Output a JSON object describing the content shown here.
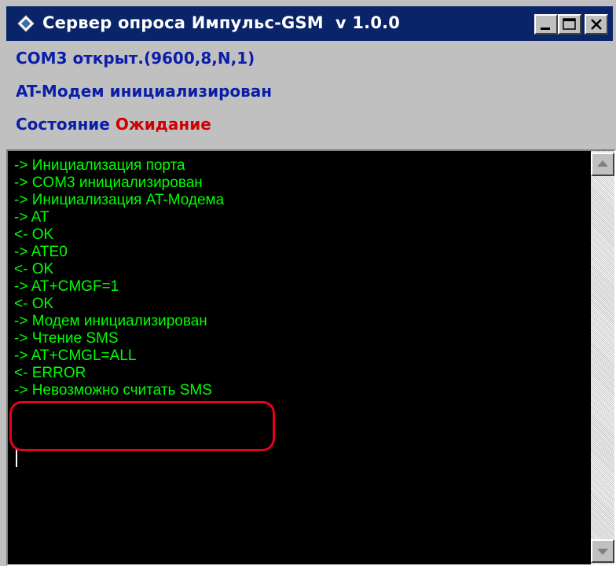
{
  "window": {
    "title": "Сервер опроса Импульс-GSM  v 1.0.0",
    "icons": {
      "app": "diamond-icon",
      "minimize": "minimize-icon",
      "maximize": "maximize-icon",
      "close": "close-icon"
    }
  },
  "status": {
    "port": "COM3 открыт.(9600,8,N,1)",
    "modem": "AT-Модем инициализирован",
    "state_label": "Состояние ",
    "state_value": "Ожидание",
    "colors": {
      "text": "#0a1ea8",
      "state_value": "#d00000"
    }
  },
  "log": {
    "text_color": "#00ff00",
    "background": "#000000",
    "lines": [
      "-> Инициализация порта",
      "-> COM3 инициализирован",
      "-> Инициализация AT-Модема",
      "-> AT",
      "<- OK",
      "-> ATE0",
      "<- OK",
      "-> AT+CMGF=1",
      "<- OK",
      "-> Модем инициализирован",
      "-> Чтение SMS",
      "-> AT+CMGL=ALL",
      "<- ERROR",
      "-> Невозможно считать SMS"
    ],
    "highlight_color": "#e8001c",
    "scrollbar": {
      "up_icon": "arrow-up-icon",
      "down_icon": "arrow-down-icon"
    }
  }
}
